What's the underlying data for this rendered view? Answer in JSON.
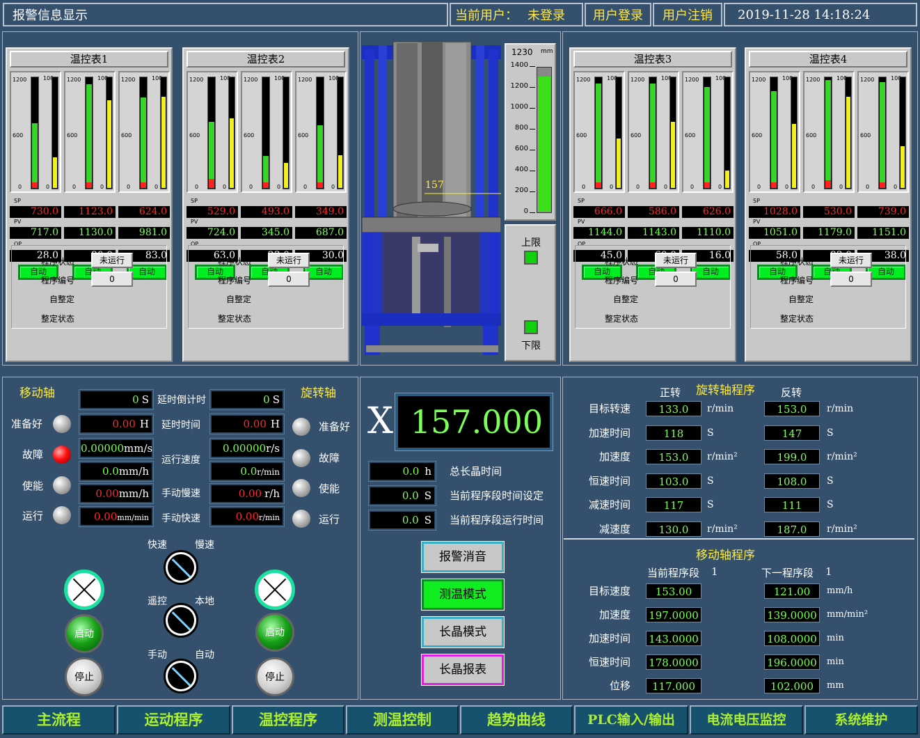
{
  "header": {
    "alarm_title": "报警信息显示",
    "user_label": "当前用户：",
    "user_status": "未登录",
    "login": "用户登录",
    "logout": "用户注销",
    "datetime": "2019-11-28  14:18:24"
  },
  "controllers": [
    {
      "title": "温控表1",
      "sp": [
        "730.0",
        "1123.0",
        "624.0"
      ],
      "pv": [
        "717.0",
        "1130.0",
        "981.0"
      ],
      "op": [
        "28.0",
        "80.0",
        "83.0"
      ],
      "pv_fill": [
        0.59,
        0.94,
        0.82
      ],
      "sp_fill": [
        0.05,
        0.05,
        0.05
      ],
      "op_fill": [
        0.28,
        0.8,
        0.83
      ]
    },
    {
      "title": "温控表2",
      "sp": [
        "529.0",
        "493.0",
        "349.0"
      ],
      "pv": [
        "724.0",
        "345.0",
        "687.0"
      ],
      "op": [
        "63.0",
        "23.0",
        "30.0"
      ],
      "pv_fill": [
        0.6,
        0.29,
        0.57
      ],
      "sp_fill": [
        0.08,
        0.05,
        0.05
      ],
      "op_fill": [
        0.63,
        0.23,
        0.3
      ]
    },
    {
      "title": "温控表3",
      "sp": [
        "666.0",
        "586.0",
        "626.0"
      ],
      "pv": [
        "1144.0",
        "1143.0",
        "1110.0"
      ],
      "op": [
        "45.0",
        "60.0",
        "16.0"
      ],
      "pv_fill": [
        0.95,
        0.95,
        0.92
      ],
      "sp_fill": [
        0.05,
        0.05,
        0.05
      ],
      "op_fill": [
        0.45,
        0.6,
        0.16
      ]
    },
    {
      "title": "温控表4",
      "sp": [
        "1028.0",
        "530.0",
        "739.0"
      ],
      "pv": [
        "1051.0",
        "1179.0",
        "1151.0"
      ],
      "op": [
        "58.0",
        "83.0",
        "38.0"
      ],
      "pv_fill": [
        0.88,
        0.98,
        0.96
      ],
      "sp_fill": [
        0.05,
        0.07,
        0.05
      ],
      "op_fill": [
        0.58,
        0.83,
        0.38
      ]
    }
  ],
  "controller_common": {
    "scale_top": "1200",
    "scale_mid": "600",
    "scale_zero": "0",
    "op_top": "100",
    "sp": "SP",
    "pv": "PV",
    "op": "OP",
    "auto": "自动",
    "prog_state": "程序状态",
    "prog_state_val": "未运行",
    "prog_num": "程序编号",
    "prog_num_val": "0",
    "self_tune": "自整定",
    "tune_state": "整定状态"
  },
  "furnace": {
    "gauge_top": "1230",
    "gauge_unit": "mm",
    "ticks": [
      "1400",
      "1200",
      "1000",
      "800",
      "600",
      "400",
      "200",
      "0"
    ],
    "position_label": "157",
    "position_fill": 0.94,
    "upper_limit": "上限",
    "lower_limit": "下限"
  },
  "move_axis": {
    "title": "移动轴",
    "ready": "准备好",
    "fault": "故障",
    "enable": "使能",
    "run": "运行",
    "v1": "0",
    "u1": "S",
    "v2": "0.00",
    "u2": "H",
    "v3": "0.00000",
    "u3": "mm/s",
    "v4": "0.0",
    "u4": "mm/h",
    "v5": "0.00",
    "u5": "mm/h",
    "v6": "0.00",
    "u6": "mm/min"
  },
  "mid_labels": {
    "countdown": "延时倒计时",
    "delay": "延时时间",
    "speed": "运行速度",
    "manual_slow": "手动慢速",
    "manual_fast": "手动快速"
  },
  "rot_axis": {
    "title": "旋转轴",
    "ready": "准备好",
    "fault": "故障",
    "enable": "使能",
    "run": "运行",
    "v1": "0",
    "u1": "S",
    "v2": "0.00",
    "u2": "H",
    "v3": "0.00000",
    "u3": "r/s",
    "v4": "0.0",
    "u4": "r/min",
    "v5": "0.00",
    "u5": "r/h",
    "v6": "0.00",
    "u6": "r/min"
  },
  "switches": {
    "fast": "快速",
    "slow": "慢速",
    "remote": "遥控",
    "local": "本地",
    "manual": "手动",
    "auto": "自动",
    "start": "启动",
    "stop": "停止"
  },
  "center": {
    "axis": "X",
    "position": "157.000",
    "t1": "0.0",
    "t1u": "h",
    "t1l": "总长晶时间",
    "t2": "0.0",
    "t2u": "S",
    "t2l": "当前程序段时间设定",
    "t3": "0.0",
    "t3u": "S",
    "t3l": "当前程序段运行时间",
    "b1": "报警消音",
    "b2": "测温模式",
    "b3": "长晶模式",
    "b4": "长晶报表"
  },
  "rot_prog": {
    "title": "旋转轴程序",
    "fwd": "正转",
    "rev": "反转",
    "rows": [
      {
        "l": "目标转速",
        "a": "133.0",
        "b": "153.0",
        "u": "r/min"
      },
      {
        "l": "加速时间",
        "a": "118",
        "b": "147",
        "u": "S"
      },
      {
        "l": "加速度",
        "a": "153.0",
        "b": "199.0",
        "u": "r/min²"
      },
      {
        "l": "恒速时间",
        "a": "103.0",
        "b": "108.0",
        "u": "S"
      },
      {
        "l": "减速时间",
        "a": "117",
        "b": "111",
        "u": "S"
      },
      {
        "l": "减速度",
        "a": "130.0",
        "b": "187.0",
        "u": "r/min²"
      }
    ]
  },
  "move_prog": {
    "title": "移动轴程序",
    "cur": "当前程序段",
    "cur_n": "1",
    "next": "下一程序段",
    "next_n": "1",
    "rows": [
      {
        "l": "目标速度",
        "a": "153.00",
        "b": "121.00",
        "u": "mm/h"
      },
      {
        "l": "加速度",
        "a": "197.0000",
        "b": "139.0000",
        "u": "mm/min²"
      },
      {
        "l": "加速时间",
        "a": "143.0000",
        "b": "108.0000",
        "u": "min"
      },
      {
        "l": "恒速时间",
        "a": "178.0000",
        "b": "196.0000",
        "u": "min"
      },
      {
        "l": "位移",
        "a": "117.000",
        "b": "102.000",
        "u": "mm"
      }
    ]
  },
  "nav": [
    "主流程",
    "运动程序",
    "温控程序",
    "测温控制",
    "趋势曲线",
    "PLC输入/输出",
    "电流电压监控",
    "系统维护"
  ]
}
